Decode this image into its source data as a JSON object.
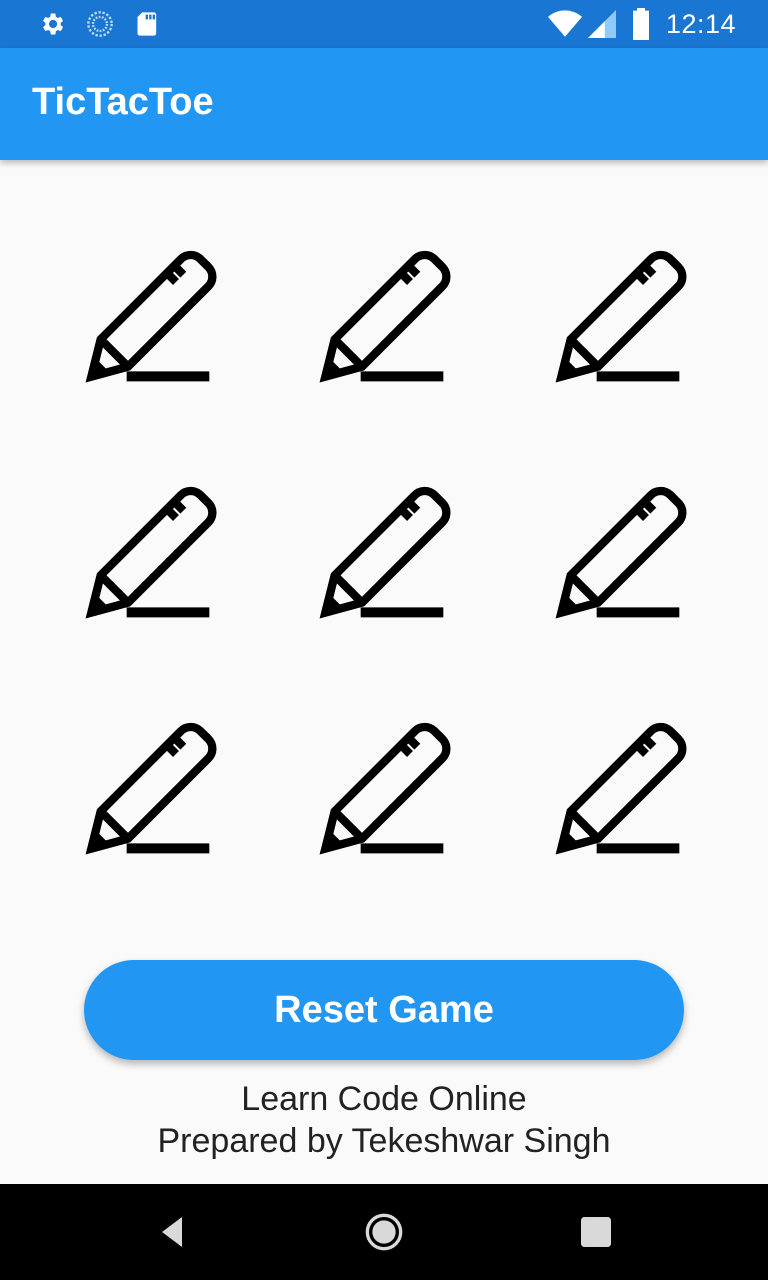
{
  "status_bar": {
    "time": "12:14",
    "icons": [
      "settings-icon",
      "sync-icon",
      "sd-card-icon",
      "wifi-icon",
      "signal-icon",
      "battery-icon"
    ]
  },
  "app_bar": {
    "title": "TicTacToe"
  },
  "board": {
    "cells": [
      {
        "icon": "edit-icon"
      },
      {
        "icon": "edit-icon"
      },
      {
        "icon": "edit-icon"
      },
      {
        "icon": "edit-icon"
      },
      {
        "icon": "edit-icon"
      },
      {
        "icon": "edit-icon"
      },
      {
        "icon": "edit-icon"
      },
      {
        "icon": "edit-icon"
      },
      {
        "icon": "edit-icon"
      }
    ]
  },
  "reset_button": {
    "label": "Reset Game"
  },
  "footer": {
    "line1": "Learn Code Online",
    "line2": "Prepared by Tekeshwar Singh"
  },
  "nav_bar": {
    "buttons": [
      "back-icon",
      "home-icon",
      "recents-icon"
    ]
  },
  "colors": {
    "primary": "#2196f3",
    "primary_dark": "#1976d2",
    "background": "#fafafa"
  }
}
